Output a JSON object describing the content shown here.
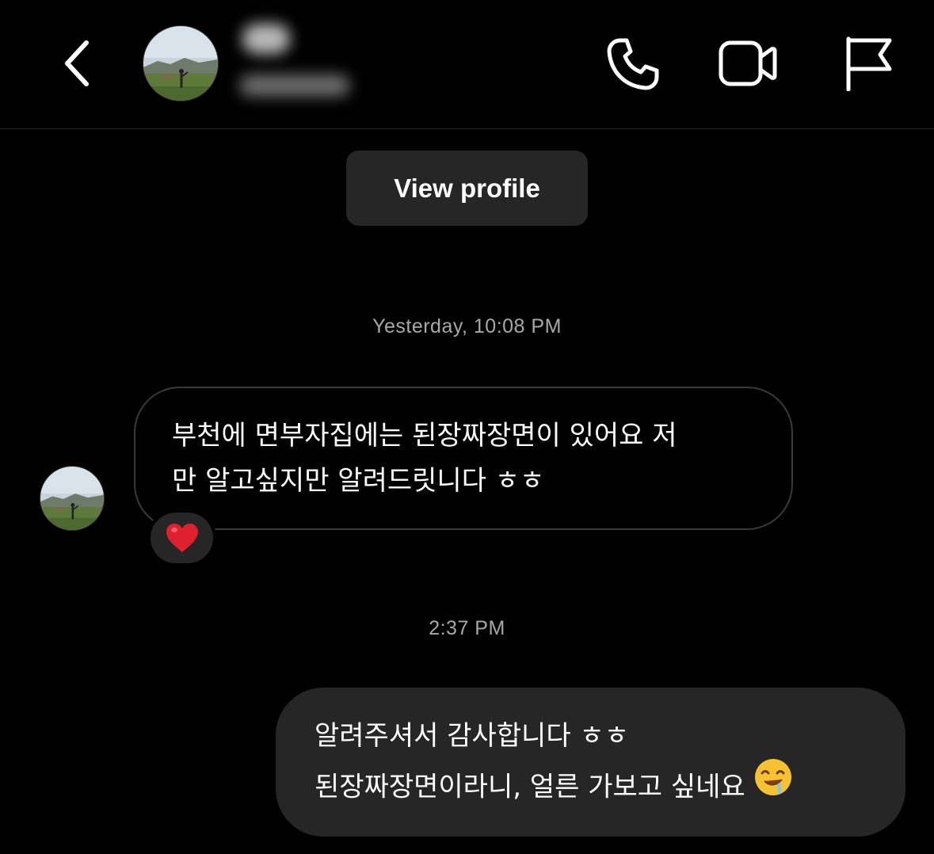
{
  "header": {
    "contact_name": "",
    "contact_handle": "",
    "icons": [
      "back-arrow-icon",
      "phone-icon",
      "video-icon",
      "flag-icon"
    ]
  },
  "view_profile_label": "View profile",
  "thread": [
    {
      "timestamp": "Yesterday, 10:08 PM",
      "direction": "received",
      "text_line1": "부천에 면부자집에는 된장짜장면이 있어요 저",
      "text_line2": "만 알고싶지만 알려드릿니다 ㅎㅎ",
      "reaction": "heart"
    },
    {
      "timestamp": "2:37 PM",
      "direction": "sent",
      "text_line1": "알려주셔서 감사합니다 ㅎㅎ",
      "text_line2": "된장짜장면이라니, 얼른 가보고 싶네요",
      "emoji": "drooling-face"
    }
  ],
  "colors": {
    "background": "#000000",
    "bubble_sent": "#262626",
    "bubble_received_border": "#3a3a3a",
    "timestamp": "#a8a8a8",
    "heart": "#e0202e"
  }
}
